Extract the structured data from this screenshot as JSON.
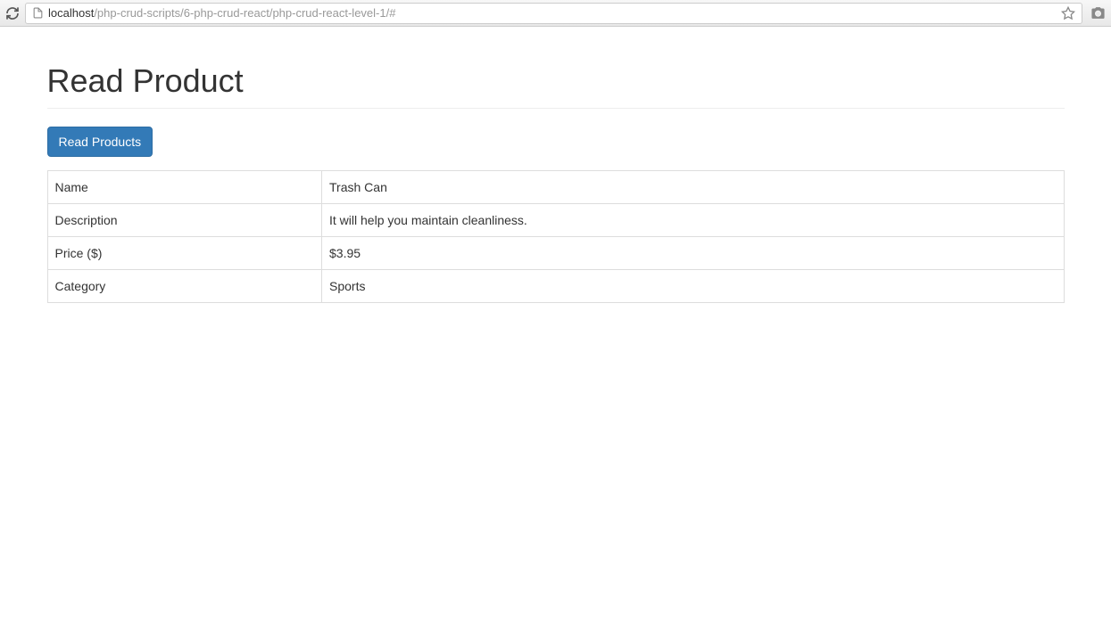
{
  "browser": {
    "url_host": "localhost",
    "url_path": "/php-crud-scripts/6-php-crud-react/php-crud-react-level-1/#"
  },
  "page": {
    "title": "Read Product",
    "button_read_products": "Read Products"
  },
  "product": {
    "rows": [
      {
        "label": "Name",
        "value": "Trash Can"
      },
      {
        "label": "Description",
        "value": "It will help you maintain cleanliness."
      },
      {
        "label": "Price ($)",
        "value": "$3.95"
      },
      {
        "label": "Category",
        "value": "Sports"
      }
    ]
  }
}
